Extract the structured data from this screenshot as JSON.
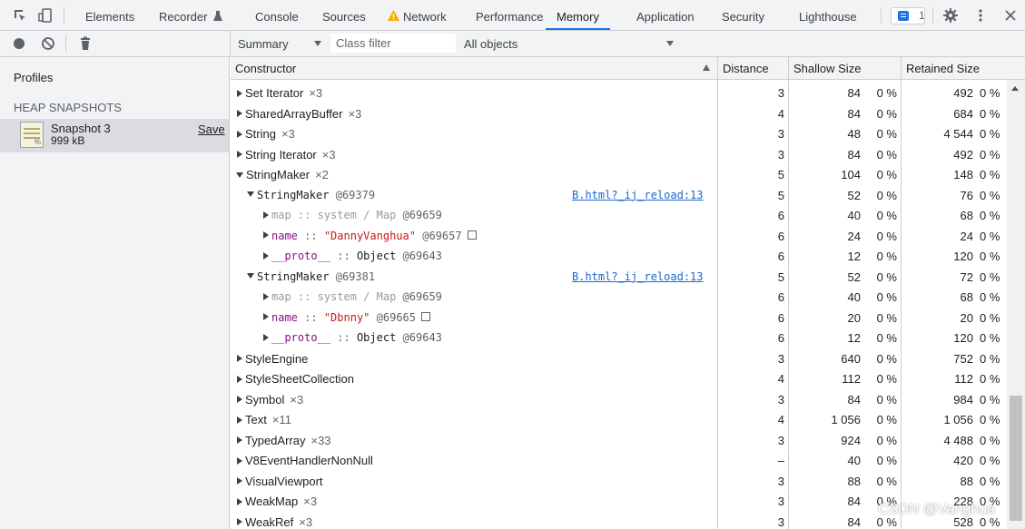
{
  "tabs": [
    {
      "label": "Elements"
    },
    {
      "label": "Recorder"
    },
    {
      "label": "Console"
    },
    {
      "label": "Sources"
    },
    {
      "label": "Network"
    },
    {
      "label": "Performance"
    },
    {
      "label": "Memory"
    },
    {
      "label": "Application"
    },
    {
      "label": "Security"
    },
    {
      "label": "Lighthouse"
    }
  ],
  "active_tab": "Memory",
  "accent_color": "#1a73e8",
  "issues_count": "1",
  "toolbar_icons": [
    "inspect-icon",
    "device-toolbar-icon",
    "recorder-flask-icon",
    "warning-icon",
    "issues-icon",
    "gear-icon",
    "more-vert-icon",
    "close-icon"
  ],
  "profile_toolbar_icons": [
    "record-icon",
    "clear-icon",
    "collect-garbage-icon"
  ],
  "filter_bar": {
    "view": "Summary",
    "class_filter_placeholder": "Class filter",
    "objects_filter": "All objects"
  },
  "sidebar": {
    "title": "Profiles",
    "section": "HEAP SNAPSHOTS",
    "snapshot": {
      "name": "Snapshot 3",
      "size": "999 kB",
      "save_label": "Save"
    }
  },
  "columns": {
    "constructor": "Constructor",
    "distance": "Distance",
    "shallow": "Shallow Size",
    "retained": "Retained Size"
  },
  "rows": [
    {
      "name": "Set Iterator",
      "count": "×3",
      "distance": "3",
      "shallow": "84",
      "shallow_pct": "0 %",
      "retained": "492",
      "retained_pct": "0 %"
    },
    {
      "name": "SharedArrayBuffer",
      "count": "×3",
      "distance": "4",
      "shallow": "84",
      "shallow_pct": "0 %",
      "retained": "684",
      "retained_pct": "0 %"
    },
    {
      "name": "String",
      "count": "×3",
      "distance": "3",
      "shallow": "48",
      "shallow_pct": "0 %",
      "retained": "4 544",
      "retained_pct": "0 %"
    },
    {
      "name": "String Iterator",
      "count": "×3",
      "distance": "3",
      "shallow": "84",
      "shallow_pct": "0 %",
      "retained": "492",
      "retained_pct": "0 %"
    },
    {
      "name": "StringMaker",
      "count": "×2",
      "distance": "5",
      "shallow": "104",
      "shallow_pct": "0 %",
      "retained": "148",
      "retained_pct": "0 %"
    },
    {
      "name": "StringMaker",
      "id": "@69379",
      "link": "B.html?_ij_reload:13",
      "distance": "5",
      "shallow": "52",
      "shallow_pct": "0 %",
      "retained": "76",
      "retained_pct": "0 %"
    },
    {
      "prop": "map",
      "sep": "::",
      "value": "system / Map",
      "id": "@69659",
      "distance": "6",
      "shallow": "40",
      "shallow_pct": "0 %",
      "retained": "68",
      "retained_pct": "0 %"
    },
    {
      "prop": "name",
      "sep": "::",
      "value": "\"DannyVanghua\"",
      "id": "@69657",
      "distance": "6",
      "shallow": "24",
      "shallow_pct": "0 %",
      "retained": "24",
      "retained_pct": "0 %"
    },
    {
      "prop": "__proto__",
      "sep": "::",
      "value": "Object",
      "id": "@69643",
      "distance": "6",
      "shallow": "12",
      "shallow_pct": "0 %",
      "retained": "120",
      "retained_pct": "0 %"
    },
    {
      "name": "StringMaker",
      "id": "@69381",
      "link": "B.html?_ij_reload:13",
      "distance": "5",
      "shallow": "52",
      "shallow_pct": "0 %",
      "retained": "72",
      "retained_pct": "0 %"
    },
    {
      "prop": "map",
      "sep": "::",
      "value": "system / Map",
      "id": "@69659",
      "distance": "6",
      "shallow": "40",
      "shallow_pct": "0 %",
      "retained": "68",
      "retained_pct": "0 %"
    },
    {
      "prop": "name",
      "sep": "::",
      "value": "\"Dbnny\"",
      "id": "@69665",
      "distance": "6",
      "shallow": "20",
      "shallow_pct": "0 %",
      "retained": "20",
      "retained_pct": "0 %"
    },
    {
      "prop": "__proto__",
      "sep": "::",
      "value": "Object",
      "id": "@69643",
      "distance": "6",
      "shallow": "12",
      "shallow_pct": "0 %",
      "retained": "120",
      "retained_pct": "0 %"
    },
    {
      "name": "StyleEngine",
      "distance": "3",
      "shallow": "640",
      "shallow_pct": "0 %",
      "retained": "752",
      "retained_pct": "0 %"
    },
    {
      "name": "StyleSheetCollection",
      "distance": "4",
      "shallow": "112",
      "shallow_pct": "0 %",
      "retained": "112",
      "retained_pct": "0 %"
    },
    {
      "name": "Symbol",
      "count": "×3",
      "distance": "3",
      "shallow": "84",
      "shallow_pct": "0 %",
      "retained": "984",
      "retained_pct": "0 %"
    },
    {
      "name": "Text",
      "count": "×11",
      "distance": "4",
      "shallow": "1 056",
      "shallow_pct": "0 %",
      "retained": "1 056",
      "retained_pct": "0 %"
    },
    {
      "name": "TypedArray",
      "count": "×33",
      "distance": "3",
      "shallow": "924",
      "shallow_pct": "0 %",
      "retained": "4 488",
      "retained_pct": "0 %"
    },
    {
      "name": "V8EventHandlerNonNull",
      "distance": "–",
      "shallow": "40",
      "shallow_pct": "0 %",
      "retained": "420",
      "retained_pct": "0 %"
    },
    {
      "name": "VisualViewport",
      "distance": "3",
      "shallow": "88",
      "shallow_pct": "0 %",
      "retained": "88",
      "retained_pct": "0 %"
    },
    {
      "name": "WeakMap",
      "count": "×3",
      "distance": "3",
      "shallow": "84",
      "shallow_pct": "0 %",
      "retained": "228",
      "retained_pct": "0 %"
    },
    {
      "name": "WeakRef",
      "count": "×3",
      "distance": "3",
      "shallow": "84",
      "shallow_pct": "0 %",
      "retained": "528",
      "retained_pct": "0 %"
    }
  ],
  "watermark": "CSDN @Vanghua"
}
